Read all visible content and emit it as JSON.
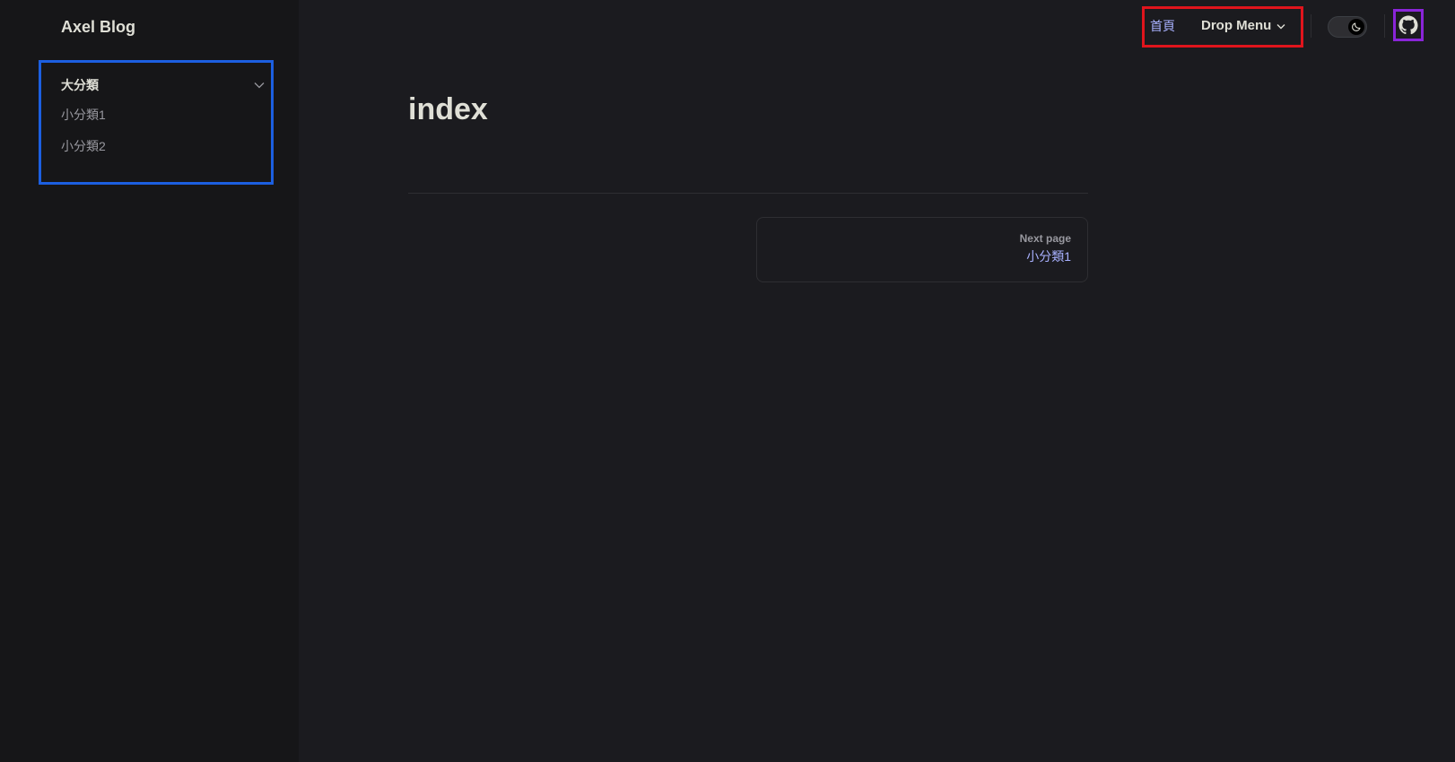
{
  "site": {
    "title": "Axel Blog"
  },
  "sidebar": {
    "group": {
      "title": "大分類",
      "items": [
        {
          "label": "小分類1"
        },
        {
          "label": "小分類2"
        }
      ]
    }
  },
  "nav": {
    "home_label": "首頁",
    "dropdown_label": "Drop Menu"
  },
  "theme": {
    "mode": "dark",
    "icon": "moon-icon"
  },
  "social": {
    "icon": "github-icon"
  },
  "page": {
    "title": "index"
  },
  "pager": {
    "next_label": "Next page",
    "next_title": "小分類1"
  },
  "colors": {
    "background": "#1b1b1f",
    "sidebar_bg": "#161618",
    "accent": "#a8b1ff",
    "text": "#dfdfd6",
    "muted": "#98989f",
    "highlight_blue": "#1c5fe0",
    "highlight_red": "#e0141c",
    "highlight_purple": "#8a25d8"
  }
}
